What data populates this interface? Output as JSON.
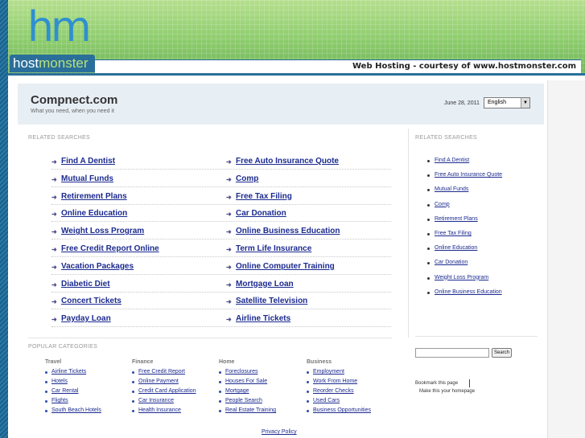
{
  "host_banner": {
    "logo_mark": "hm",
    "logo_host": "host",
    "logo_monster": "monster",
    "hosting_text": "Web Hosting - courtesy of www.hostmonster.com"
  },
  "header": {
    "site_title": "Compnect.com",
    "tagline": "What you need, when you need it",
    "date": "June 28, 2011",
    "language": "English"
  },
  "main": {
    "related_label": "RELATED SEARCHES",
    "left_column": [
      "Find A Dentist",
      "Mutual Funds",
      "Retirement Plans",
      "Online Education",
      "Weight Loss Program",
      "Free Credit Report Online",
      "Vacation Packages",
      "Diabetic Diet",
      "Concert Tickets",
      "Payday Loan"
    ],
    "right_column": [
      "Free Auto Insurance Quote",
      "Comp",
      "Free Tax Filing",
      "Car Donation",
      "Online Business Education",
      "Term Life Insurance",
      "Online Computer Training",
      "Mortgage Loan",
      "Satellite Television",
      "Airline Tickets"
    ]
  },
  "sidebar": {
    "related_label": "RELATED SEARCHES",
    "items": [
      "Find A Dentist",
      "Free Auto Insurance Quote",
      "Mutual Funds",
      "Comp",
      "Retirement Plans",
      "Free Tax Filing",
      "Online Education",
      "Car Donation",
      "Weight Loss Program",
      "Online Business Education"
    ],
    "search_button": "Search",
    "bookmark": "Bookmark this page",
    "homepage": "Make this your homepage"
  },
  "popular": {
    "label": "POPULAR CATEGORIES",
    "categories": [
      {
        "title": "Travel",
        "items": [
          "Airline Tickets",
          "Hotels",
          "Car Rental",
          "Flights",
          "South Beach Hotels"
        ]
      },
      {
        "title": "Finance",
        "items": [
          "Free Credit Report",
          "Online Payment",
          "Credit Card Application",
          "Car Insurance",
          "Health Insurance"
        ]
      },
      {
        "title": "Home",
        "items": [
          "Foreclosures",
          "Houses For Sale",
          "Mortgage",
          "People Search",
          "Real Estate Training"
        ]
      },
      {
        "title": "Business",
        "items": [
          "Employment",
          "Work From Home",
          "Reorder Checks",
          "Used Cars",
          "Business Opportunities"
        ]
      }
    ]
  },
  "footer": {
    "privacy": "Privacy Policy"
  },
  "colors": {
    "link": "#1b2a8f",
    "brand_blue": "#2a6f99",
    "brand_green": "#8ccb6c"
  },
  "icons": {
    "keyword_bullet": "arrow-right-icon",
    "list_bullet": "dot-icon",
    "dropdown": "chevron-down-icon"
  }
}
